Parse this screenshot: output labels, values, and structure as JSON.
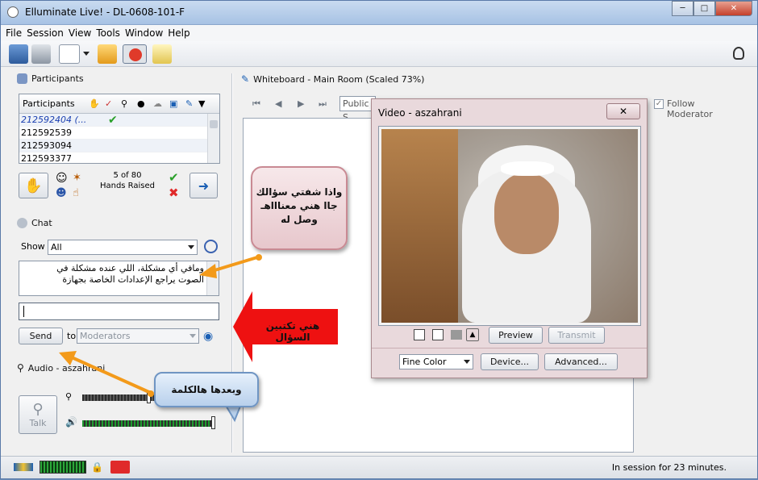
{
  "window": {
    "title": "Elluminate Live! - DL-0608-101-F"
  },
  "menu": [
    "File",
    "Session",
    "View",
    "Tools",
    "Window",
    "Help"
  ],
  "participants": {
    "heading": "Participants",
    "column_header": "Participants",
    "rows": [
      "212592404 (...",
      "212592539",
      "212593094",
      "212593377"
    ],
    "hands_count": "5 of 80",
    "hands_label": "Hands Raised"
  },
  "chat": {
    "heading": "Chat",
    "show_label": "Show",
    "show_value": "All",
    "messages": [
      "ومافي أي مشكلة، اللي عنده مشكلة في",
      "الصوت يراجع الإعدادات الخاصة بجهازة"
    ],
    "send_label": "Send",
    "to_label": "to",
    "to_value": "Moderators"
  },
  "audio": {
    "heading": "Audio - aszahrani",
    "talk_label": "Talk"
  },
  "whiteboard": {
    "heading": "Whiteboard - Main Room (Scaled 73%)",
    "screen_select": "Public S",
    "follow_label": "Follow Moderator"
  },
  "video": {
    "title": "Video - aszahrani",
    "preview_label": "Preview",
    "transmit_label": "Transmit",
    "color_value": "Fine Color",
    "device_label": "Device...",
    "advanced_label": "Advanced..."
  },
  "annotations": {
    "bubble_top": [
      "واذا شفتي سؤالك",
      "جاا هني معناااهـ",
      "وصل له"
    ],
    "arrow_label": "هني تكتبين السؤال",
    "bubble_bottom": "وبعدها هالكلمة"
  },
  "status": {
    "session_time": "In session for 23 minutes."
  },
  "colors": {
    "accent": "#1a5fb4",
    "arrow_red": "#ee1111",
    "annotation_arrow": "#f39a1a"
  }
}
